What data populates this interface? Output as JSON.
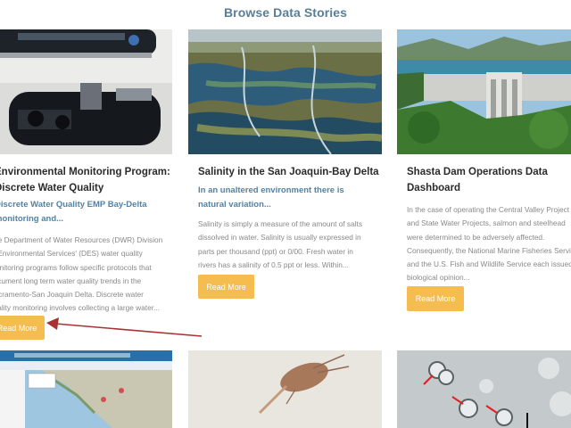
{
  "section": {
    "title": "Browse Data Stories"
  },
  "cards": [
    {
      "title_lines": [
        "Environmental Monitoring Program:",
        "Discrete Water Quality"
      ],
      "sub_lines": [
        "Discrete Water Quality EMP Bay-Delta",
        "monitoring and..."
      ],
      "desc_lines": [
        "The Department of Water Resources (DWR) Division",
        "of Environmental Services' (DES) water quality",
        "monitoring programs follow specific protocols that",
        "document long term water quality trends in the",
        "Sacramento-San Joaquin Delta. Discrete water",
        "quality monitoring involves collecting a large water..."
      ],
      "button": "Read More"
    },
    {
      "title_lines": [
        "Salinity in the San Joaquin-Bay Delta"
      ],
      "sub_lines": [
        "In an unaltered environment there is",
        "natural variation..."
      ],
      "desc_lines": [
        "Salinity is simply a measure of the amount of salts",
        "dissolved in water. Salinity is usually expressed in",
        "parts per thousand (ppt) or 0/00. Fresh water in",
        "rivers has a salinity of 0.5 ppt or less. Within..."
      ],
      "button": "Read More"
    },
    {
      "title_lines": [
        "Shasta Dam Operations Data",
        "Dashboard"
      ],
      "sub_lines": [],
      "desc_lines": [
        "In the case of operating the Central Valley Project",
        "and State Water Projects, salmon and steelhead",
        "were determined to be adversely affected.",
        "Consequently, the National Marine Fisheries Service",
        "and the U.S. Fish and Wildlife Service each issued a",
        "biological opinion..."
      ],
      "button": "Read More"
    }
  ],
  "colors": {
    "button": "#f5bd4f",
    "title": "#5b7e97",
    "subtitle": "#4f83a7",
    "arrow": "#a83232"
  }
}
